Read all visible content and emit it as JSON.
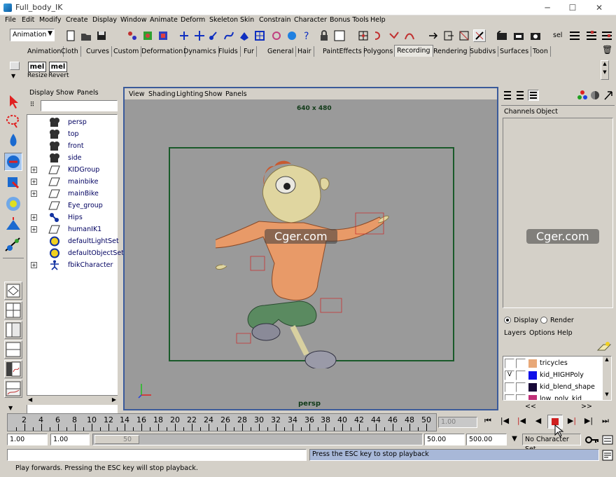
{
  "window": {
    "title": "Full_body_IK"
  },
  "menus": [
    "File",
    "Edit",
    "Modify",
    "Create",
    "Display",
    "Window",
    "Animate",
    "Deform",
    "Skeleton",
    "Skin",
    "Constrain",
    "Character",
    "Bonus Tools",
    "Help"
  ],
  "toolbar": {
    "mode_select": "Animation",
    "sel_label": "sel"
  },
  "shelf_tabs": [
    "Animation",
    "Cloth",
    "Curves",
    "Custom",
    "Deformation",
    "Dynamics",
    "Fluids",
    "Fur",
    "General",
    "Hair",
    "PaintEffects",
    "Polygons",
    "Recording",
    "Rendering",
    "Subdivs",
    "Surfaces",
    "Toon"
  ],
  "shelf_active": "Recording",
  "shelf_buttons": [
    {
      "icon": "mel",
      "label": "Resize"
    },
    {
      "icon": "mel",
      "label": "Revert"
    }
  ],
  "outliner": {
    "menu": [
      "Display",
      "Show",
      "Panels"
    ],
    "items": [
      {
        "label": "persp",
        "icon": "camera-icon",
        "expand": false
      },
      {
        "label": "top",
        "icon": "camera-icon",
        "expand": false
      },
      {
        "label": "front",
        "icon": "camera-icon",
        "expand": false
      },
      {
        "label": "side",
        "icon": "camera-icon",
        "expand": false
      },
      {
        "label": "KIDGroup",
        "icon": "transform-icon",
        "expand": true
      },
      {
        "label": "mainbike",
        "icon": "transform-icon",
        "expand": true
      },
      {
        "label": "mainBike",
        "icon": "transform-icon",
        "expand": true
      },
      {
        "label": "Eye_group",
        "icon": "transform-icon",
        "expand": false
      },
      {
        "label": "Hips",
        "icon": "joint-icon",
        "expand": true
      },
      {
        "label": "humanIK1",
        "icon": "transform-icon",
        "expand": true
      },
      {
        "label": "defaultLightSet",
        "icon": "set-icon",
        "expand": false
      },
      {
        "label": "defaultObjectSet",
        "icon": "set-icon",
        "expand": false
      },
      {
        "label": "fbikCharacter",
        "icon": "character-icon",
        "expand": true
      }
    ]
  },
  "viewport": {
    "menu": [
      "View",
      "Shading",
      "Lighting",
      "Show",
      "Panels"
    ],
    "resolution": "640 x 480",
    "camera": "persp"
  },
  "channelbox": {
    "menu": [
      "Channels",
      "Object"
    ]
  },
  "layers": {
    "display": "Display",
    "render": "Render",
    "menu": [
      "Layers",
      "Options",
      "Help"
    ],
    "items": [
      {
        "name": "tricycles",
        "color": "#e8a878",
        "visible": ""
      },
      {
        "name": "kid_HIGHPoly",
        "color": "#1010e8",
        "visible": "V"
      },
      {
        "name": "kid_blend_shape",
        "color": "#180838",
        "visible": ""
      },
      {
        "name": "low_poly_kid",
        "color": "#c03078",
        "visible": ""
      }
    ],
    "nav_left": "<<",
    "nav_right": ">>"
  },
  "timeline": {
    "ticks": [
      "2",
      "4",
      "6",
      "8",
      "10",
      "12",
      "14",
      "16",
      "18",
      "20",
      "22",
      "24",
      "26",
      "28",
      "30",
      "32",
      "34",
      "36",
      "38",
      "40",
      "42",
      "44",
      "46",
      "48",
      "50"
    ],
    "current": "1.00"
  },
  "range": {
    "start": "1.00",
    "playback_start": "1.00",
    "slider_value": "50",
    "playback_end": "50.00",
    "end": "500.00",
    "character_set": "No Character Set"
  },
  "status": {
    "command_response": "Press the ESC key to stop playback",
    "help": "Play forwards. Pressing the ESC key will stop playback."
  },
  "watermarks": [
    "Cger.com",
    "Cger.com"
  ],
  "colors": {
    "viewport_bg": "#9a9a9a",
    "resolution_gate": "#1a5a2a",
    "active_border": "#3a5a9a"
  }
}
